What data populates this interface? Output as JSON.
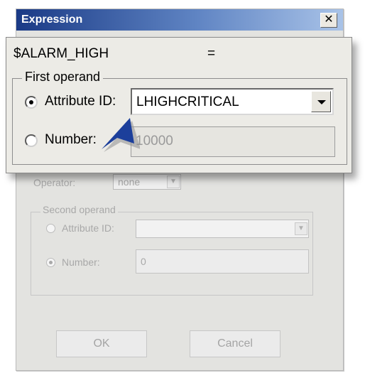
{
  "dialog": {
    "title": "Expression",
    "close_glyph": "✕",
    "operator_label": "Operator:",
    "operator_value": "none",
    "second_operand": {
      "title": "Second operand",
      "attribute_label": "Attribute ID:",
      "attribute_value": "",
      "number_label": "Number:",
      "number_value": "0",
      "selected": "number"
    },
    "ok_label": "OK",
    "cancel_label": "Cancel"
  },
  "zoom": {
    "expression_name": "$ALARM_HIGH",
    "equals": "=",
    "first_operand": {
      "title": "First operand",
      "attribute_label": "Attribute ID:",
      "attribute_value": "LHIGHCRITICAL",
      "number_label": "Number:",
      "number_value": "10000",
      "selected": "attribute"
    }
  },
  "colors": {
    "titlebar_start": "#1a3a86",
    "titlebar_end": "#a9c3e8",
    "pointer": "#1c3f9b"
  },
  "icons": {
    "close": "close-icon",
    "dropdown": "chevron-down-icon",
    "pointer": "callout-arrow-icon"
  }
}
